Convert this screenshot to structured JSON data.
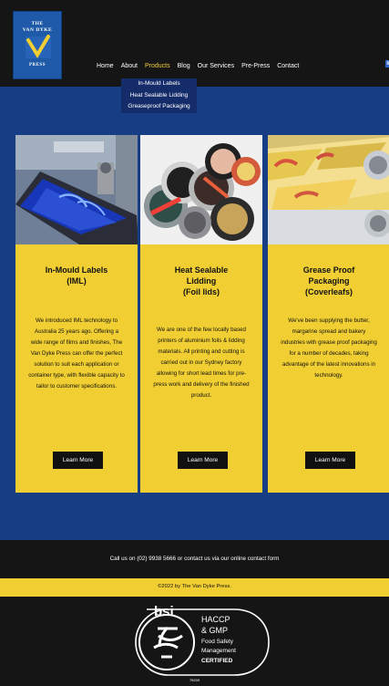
{
  "logo": {
    "line1": "THE",
    "line2": "VAN DYKE",
    "line3": "PRESS"
  },
  "nav": {
    "items": [
      {
        "label": "Home"
      },
      {
        "label": "About"
      },
      {
        "label": "Products",
        "active": true
      },
      {
        "label": "Blog"
      },
      {
        "label": "Our Services"
      },
      {
        "label": "Pre-Press"
      },
      {
        "label": "Contact"
      }
    ]
  },
  "products_dropdown": {
    "items": [
      {
        "label": "In-Mould Labels"
      },
      {
        "label": "Heat Sealable Lidding"
      },
      {
        "label": "Greaseproof Packaging"
      }
    ]
  },
  "social": {
    "icon": "linkedin-icon",
    "label": "in"
  },
  "cards": [
    {
      "title": "In-Mould Labels\n(IML)",
      "text": "We introduced IML technology to Australia 25 years ago. Offering a wide range of films and finishes, The Van Dyke Press can offer the perfect solution to suit each application or container type, with flexible capacity to tailor to customer specifications.",
      "button": "Learn More"
    },
    {
      "title": "Heat Sealable\nLidding\n(Foil lids)",
      "text": "We are one of the few locally based printers of aluminium foils & lidding materials. All printing and cutting is carried out in our Sydney factory allowing for short lead times for pre-press work and delivery of the finished product.",
      "button": "Learn More"
    },
    {
      "title": "Grease Proof\nPackaging\n(Coverleafs)",
      "text": "We've been supplying the butter, margarine spread and bakery industries with grease proof packaging for a number of decades, taking advantage of the latest innovations in technology.",
      "button": "Learn More"
    }
  ],
  "footer": {
    "contact": "Call us on (02) 9938 5666 or contact us via our online contact form",
    "copyright": "©2022 by The Van Dyke Press."
  },
  "certification": {
    "brand": "bsi",
    "line1": "HACCP",
    "line2": "& GMP",
    "line3": "Food Safety",
    "line4": "Management",
    "line5": "CERTIFIED",
    "number": "79209"
  },
  "colors": {
    "yellow": "#f1cf33",
    "blue": "#173e84",
    "dark": "#151515"
  }
}
